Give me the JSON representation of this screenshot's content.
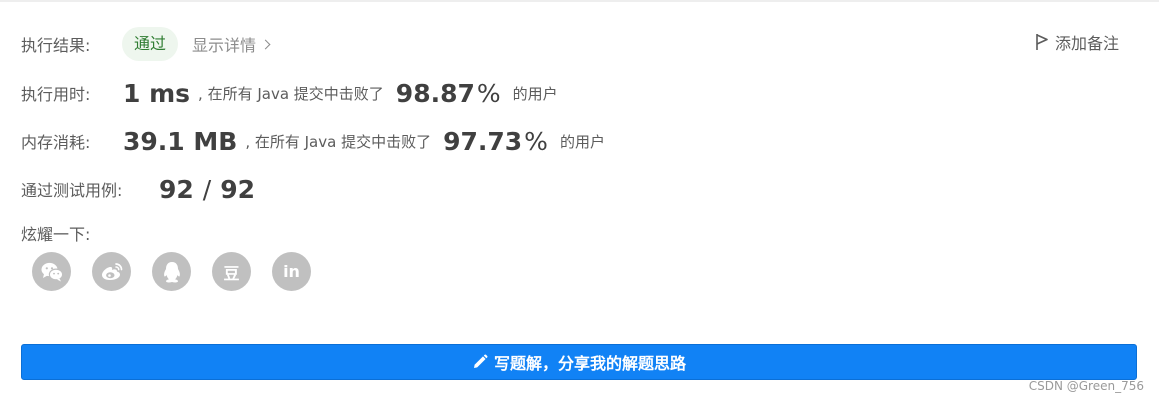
{
  "result": {
    "label": "执行结果:",
    "status": "通过",
    "detail_link": "显示详情",
    "add_note": "添加备注"
  },
  "runtime": {
    "label": "执行用时:",
    "value": "1 ms",
    "text_before": ", 在所有 Java 提交中击败了",
    "percent": "98.87",
    "percent_unit": "%",
    "text_after": "的用户"
  },
  "memory": {
    "label": "内存消耗:",
    "value": "39.1 MB",
    "text_before": ", 在所有 Java 提交中击败了",
    "percent": "97.73",
    "percent_unit": "%",
    "text_after": "的用户"
  },
  "testcases": {
    "label": "通过测试用例:",
    "passed": "92",
    "separator": "/",
    "total": "92"
  },
  "share": {
    "label": "炫耀一下:",
    "icons": [
      "wechat-icon",
      "weibo-icon",
      "qq-icon",
      "douban-icon",
      "linkedin-icon"
    ],
    "douban_glyph": "豆",
    "linkedin_glyph": "in"
  },
  "write_button": {
    "label": "写题解，分享我的解题思路"
  },
  "watermark": "CSDN @Green_756",
  "colors": {
    "primary": "#1182f5",
    "pass_bg": "#eef6ee",
    "pass_text": "#2f7d32",
    "icon_gray": "#c0c0c0"
  }
}
